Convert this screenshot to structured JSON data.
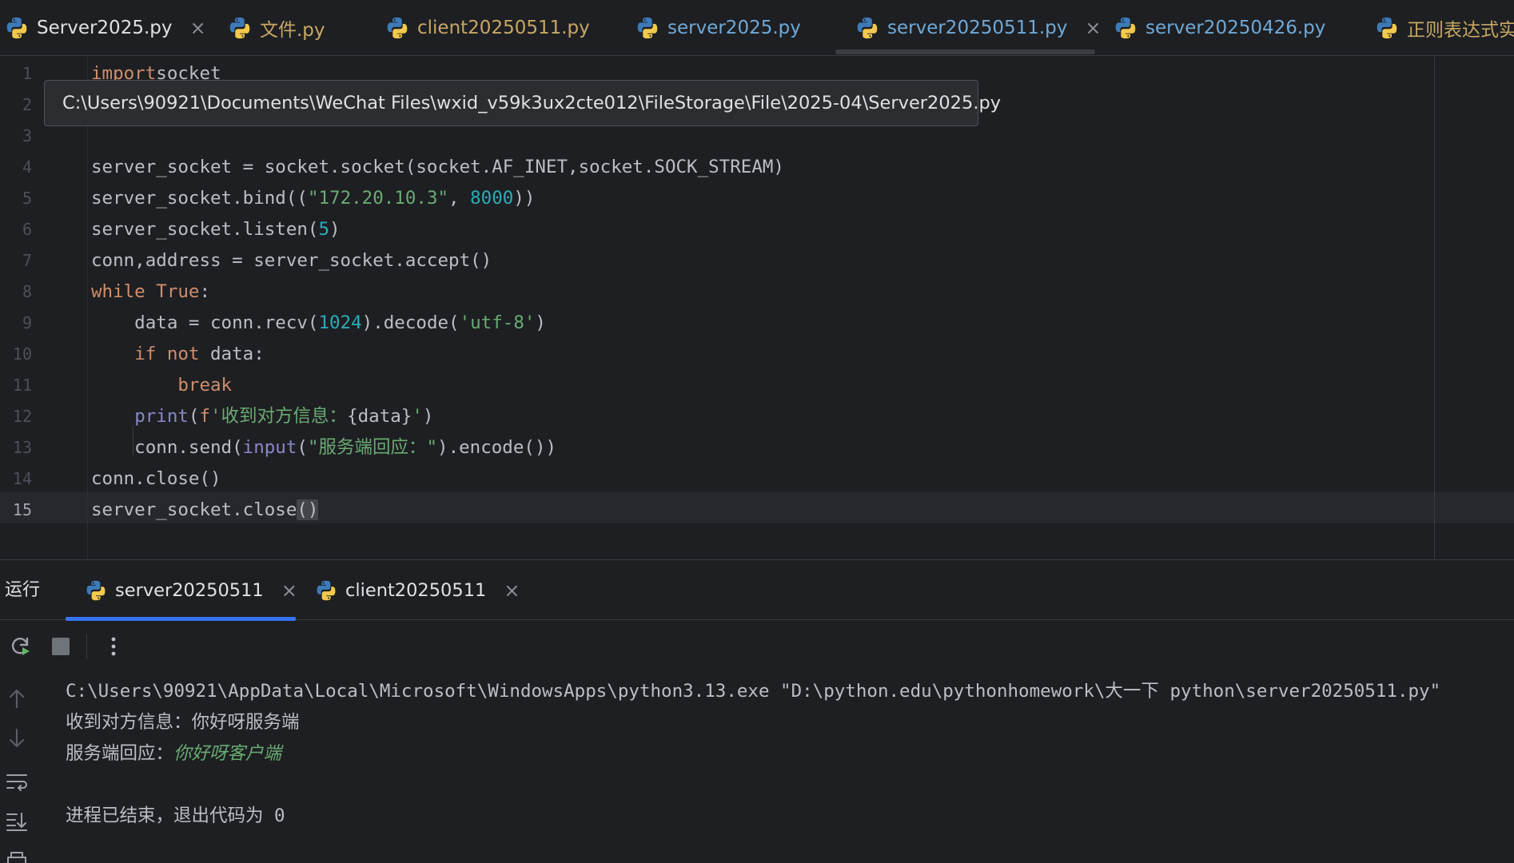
{
  "tabs": [
    {
      "label": "Server2025.py",
      "style": "first",
      "closable": true
    },
    {
      "label": "文件.py",
      "style": "modified",
      "closable": false
    },
    {
      "label": "client20250511.py",
      "style": "modified",
      "closable": false
    },
    {
      "label": "server2025.py",
      "style": "normal",
      "closable": false
    },
    {
      "label": "server20250511.py",
      "style": "active",
      "closable": true
    },
    {
      "label": "server20250426.py",
      "style": "normal",
      "closable": false
    },
    {
      "label": "正则表达式实",
      "style": "modified",
      "closable": false
    }
  ],
  "tab_close_glyph": "×",
  "tooltip": {
    "path": "C:\\Users\\90921\\Documents\\WeChat Files\\wxid_v59k3ux2cte012\\FileStorage\\File\\2025-04\\Server2025.py"
  },
  "editor": {
    "line_numbers": [
      "1",
      "2",
      "3",
      "4",
      "5",
      "6",
      "7",
      "8",
      "9",
      "10",
      "11",
      "12",
      "13",
      "14",
      "15"
    ],
    "current_line": 15,
    "lines": [
      {
        "n": 1,
        "tokens": [
          [
            "kw",
            "import"
          ],
          [
            "",
            "socket"
          ]
        ]
      },
      {
        "n": 2,
        "tokens": []
      },
      {
        "n": 3,
        "tokens": []
      },
      {
        "n": 4,
        "tokens": [
          [
            "",
            "server_socket = socket.socket(socket.AF_INET,socket.SOCK_STREAM)"
          ]
        ]
      },
      {
        "n": 5,
        "tokens": [
          [
            "",
            "server_socket.bind(("
          ],
          [
            "str",
            "\"172.20.10.3\""
          ],
          [
            "",
            ", "
          ],
          [
            "num",
            "8000"
          ],
          [
            "",
            "))"
          ]
        ]
      },
      {
        "n": 6,
        "tokens": [
          [
            "",
            "server_socket.listen("
          ],
          [
            "num",
            "5"
          ],
          [
            "",
            ")"
          ]
        ]
      },
      {
        "n": 7,
        "tokens": [
          [
            "",
            "conn,address = server_socket.accept()"
          ]
        ]
      },
      {
        "n": 8,
        "tokens": [
          [
            "kw",
            "while"
          ],
          [
            "",
            " "
          ],
          [
            "kw",
            "True"
          ],
          [
            "",
            ":"
          ]
        ]
      },
      {
        "n": 9,
        "tokens": [
          [
            "",
            "    data = conn.recv("
          ],
          [
            "num",
            "1024"
          ],
          [
            "",
            ").decode("
          ],
          [
            "str",
            "'utf-8'"
          ],
          [
            "",
            ")"
          ]
        ]
      },
      {
        "n": 10,
        "tokens": [
          [
            "",
            "    "
          ],
          [
            "kw",
            "if"
          ],
          [
            "",
            " "
          ],
          [
            "kw",
            "not"
          ],
          [
            "",
            " data:"
          ]
        ]
      },
      {
        "n": 11,
        "tokens": [
          [
            "",
            "        "
          ],
          [
            "kw",
            "break"
          ]
        ]
      },
      {
        "n": 12,
        "tokens": [
          [
            "",
            "    "
          ],
          [
            "bi",
            "print"
          ],
          [
            "",
            "("
          ],
          [
            "kw",
            "f"
          ],
          [
            "str",
            "'收到对方信息："
          ],
          [
            "",
            "{data}"
          ],
          [
            "str",
            "'"
          ],
          [
            "",
            ")"
          ]
        ]
      },
      {
        "n": 13,
        "tokens": [
          [
            "",
            "    conn.send("
          ],
          [
            "bi",
            "input"
          ],
          [
            "",
            "("
          ],
          [
            "str",
            "\"服务端回应：\""
          ],
          [
            "",
            ").encode())"
          ]
        ]
      },
      {
        "n": 14,
        "tokens": [
          [
            "",
            "conn.close()"
          ]
        ]
      },
      {
        "n": 15,
        "tokens": [
          [
            "",
            "server_socket.close"
          ],
          [
            "brace",
            "()"
          ]
        ]
      }
    ]
  },
  "run_panel": {
    "title": "运行",
    "tabs": [
      {
        "label": "server20250511"
      },
      {
        "label": "client20250511"
      }
    ],
    "console": [
      {
        "text": "C:\\Users\\90921\\AppData\\Local\\Microsoft\\WindowsApps\\python3.13.exe \"D:\\python.edu\\pythonhomework\\大一下 python\\server20250511.py\""
      },
      {
        "text": "收到对方信息：你好呀服务端"
      },
      {
        "prefix": "服务端回应：",
        "input": "你好呀客户端"
      },
      {
        "text": ""
      },
      {
        "text": "进程已结束，退出代码为 0"
      }
    ]
  },
  "icons": {
    "tab_file": "python-file-icon",
    "rerun": "rerun-icon",
    "stop": "stop-icon",
    "more": "more-options-icon",
    "scroll_up": "arrow-up-icon",
    "scroll_down": "arrow-down-icon",
    "soft_wrap": "soft-wrap-icon",
    "scroll_to_end": "scroll-to-end-icon",
    "print": "print-icon"
  },
  "colors": {
    "background": "#1e1f22",
    "keyword": "#cf8e6d",
    "string": "#6aab73",
    "number": "#2aacb8",
    "builtin": "#8888c6",
    "accent": "#3574f0",
    "python_blue": "#3d7ab8",
    "python_yellow": "#f2c94c"
  }
}
